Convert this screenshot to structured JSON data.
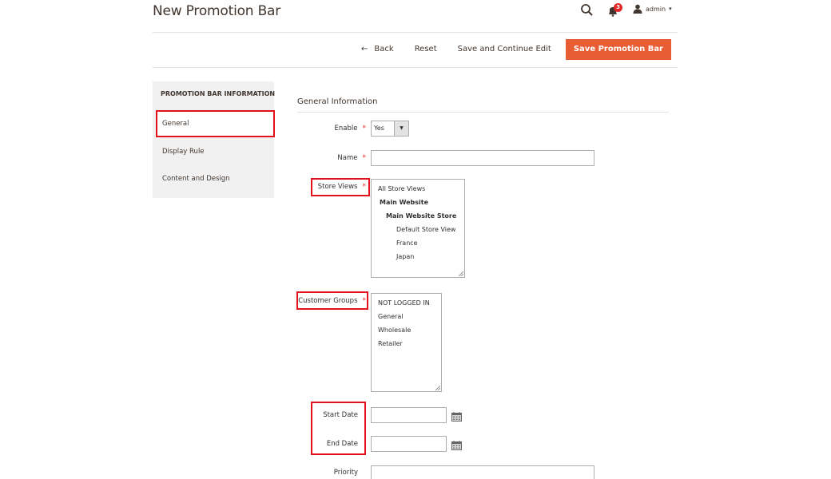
{
  "header": {
    "title": "New Promotion Bar",
    "notification_count": "3",
    "user_name": "admin",
    "caret": "▾"
  },
  "toolbar": {
    "back_arrow": "←",
    "back_label": "Back",
    "reset_label": "Reset",
    "save_continue_label": "Save and Continue Edit",
    "save_label": "Save Promotion Bar",
    "primary_color": "#e85d33"
  },
  "sidebar": {
    "title": "PROMOTION BAR INFORMATION",
    "items": [
      {
        "label": "General",
        "active": true
      },
      {
        "label": "Display Rule",
        "active": false
      },
      {
        "label": "Content and Design",
        "active": false
      }
    ]
  },
  "form": {
    "section_title": "General Information",
    "required_mark": "*",
    "enable": {
      "label": "Enable",
      "value": "Yes",
      "arrow": "▼"
    },
    "name": {
      "label": "Name",
      "value": ""
    },
    "store_views": {
      "label": "Store Views",
      "options": [
        {
          "label": "All Store Views",
          "level": 0,
          "bold": false
        },
        {
          "label": "Main Website",
          "level": 0,
          "bold": true
        },
        {
          "label": "Main Website Store",
          "level": 1,
          "bold": true
        },
        {
          "label": "Default Store View",
          "level": 2,
          "bold": false
        },
        {
          "label": "France",
          "level": 2,
          "bold": false
        },
        {
          "label": "Japan",
          "level": 2,
          "bold": false
        }
      ]
    },
    "customer_groups": {
      "label": "Customer Groups",
      "options": [
        "NOT LOGGED IN",
        "General",
        "Wholesale",
        "Retailer"
      ]
    },
    "start_date": {
      "label": "Start Date",
      "value": ""
    },
    "end_date": {
      "label": "End Date",
      "value": ""
    },
    "priority": {
      "label": "Priority",
      "value": ""
    }
  },
  "highlight_color": "#e3111b"
}
